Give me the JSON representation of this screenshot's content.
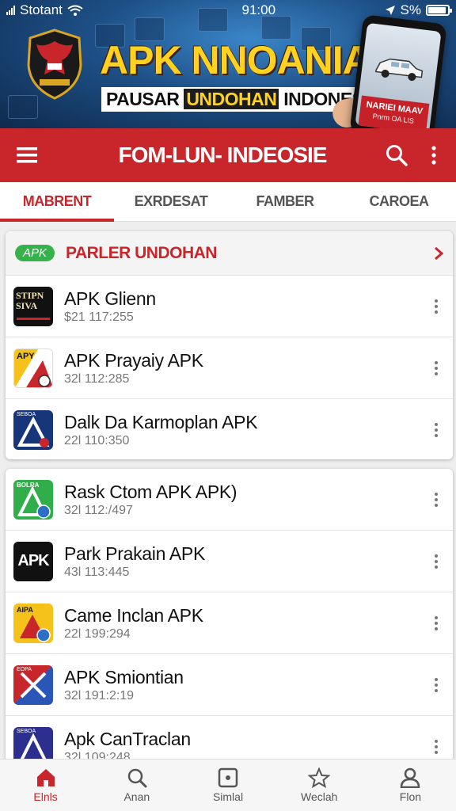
{
  "status": {
    "carrier": "Stotant",
    "time": "91:00",
    "battery": "S%"
  },
  "banner": {
    "title": "APK NNOANIA",
    "sub_pre": "PAUSAR ",
    "sub_hl": "UNDOHAN",
    "sub_post": " INDONESIA",
    "promo_line1": "NARIEI MAAV",
    "promo_line2": "Pnrm OA LIS"
  },
  "appbar": {
    "title": "FOM-LUN- INDEOSIE"
  },
  "tabs": [
    {
      "label": "MABRENT"
    },
    {
      "label": "EXRDESAT"
    },
    {
      "label": "FAMBER"
    },
    {
      "label": "CAROEA"
    }
  ],
  "section": {
    "chip": "APK",
    "title": "PARLER UNDOHAN"
  },
  "apps": [
    {
      "name": "APK Glienn",
      "meta": "$21 117:255",
      "icon": "stpn-siva-icon",
      "icon_text": "STIPN SIVA"
    },
    {
      "name": "APK Prayaiy APK",
      "meta": "32l 112:285",
      "icon": "apy-icon",
      "icon_text": "APY"
    },
    {
      "name": "Dalk Da Karmoplan APK",
      "meta": "22l 110:350",
      "icon": "a-triangle-icon",
      "icon_text": "SEBOA"
    },
    {
      "name": "Rask Ctom APK APK)",
      "meta": "32l 112:/497",
      "icon": "green-a-icon",
      "icon_text": "BOLRA"
    },
    {
      "name": "Park Prakain APK",
      "meta": "43l 113:445",
      "icon": "apk-black-icon",
      "icon_text": "APK"
    },
    {
      "name": "Came Inclan APK",
      "meta": "22l 199:294",
      "icon": "yellow-a-icon",
      "icon_text": "AIPA"
    },
    {
      "name": "APK Smiontian",
      "meta": "32l 191:2:19",
      "icon": "split-x-icon",
      "icon_text": "EOPA"
    },
    {
      "name": "Apk CanTraclan",
      "meta": "32l 109:248",
      "icon": "purple-a-icon",
      "icon_text": "SEBOA"
    }
  ],
  "nav": [
    {
      "label": "Elnls",
      "icon": "home-icon"
    },
    {
      "label": "Anan",
      "icon": "search-icon"
    },
    {
      "label": "Simlal",
      "icon": "square-icon"
    },
    {
      "label": "Weclah",
      "icon": "star-icon"
    },
    {
      "label": "Flon",
      "icon": "person-icon"
    }
  ],
  "colors": {
    "accent": "#c8262b",
    "green": "#36b24a",
    "banner_yellow": "#ffd21f"
  }
}
